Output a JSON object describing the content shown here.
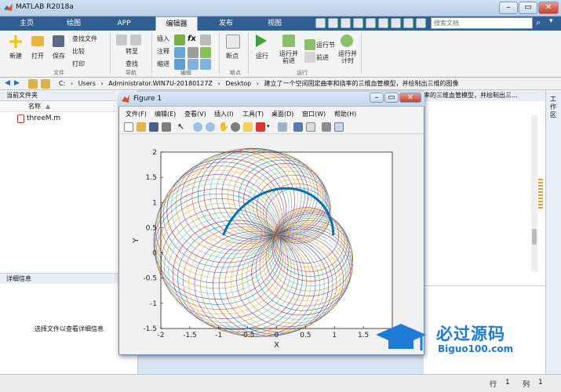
{
  "window": {
    "title": "MATLAB R2018a"
  },
  "tabs": [
    {
      "label": "主页"
    },
    {
      "label": "绘图"
    },
    {
      "label": "APP"
    },
    {
      "label": "编辑器"
    },
    {
      "label": "发布"
    },
    {
      "label": "视图"
    }
  ],
  "search": {
    "placeholder": "搜索文档"
  },
  "ribbon": {
    "file_group": "文件",
    "nav_group": "导航",
    "edit_group": "编辑",
    "breakpoint_group": "断点",
    "run_group": "运行",
    "new": "新建",
    "open": "打开",
    "save": "保存",
    "find_files": "查找文件",
    "compare": "比较",
    "print": "打印",
    "goto": "转至",
    "find": "查找",
    "insert": "插入",
    "comment": "注释",
    "indent": "缩进",
    "fx": "fx",
    "breakpoints": "断点",
    "run": "运行",
    "run_advance": "运行并\n前进",
    "run_section": "运行节",
    "advance": "前进",
    "run_time": "运行并\n计时"
  },
  "address": {
    "drive": "C:",
    "parts": [
      "Users",
      "Administrator.WIN7U-20180127Z",
      "Desktop",
      "建立了一个空间固定曲率和挠率的三维血管模型，并绘制出三维的图像"
    ]
  },
  "current_folder": {
    "header": "当前文件夹",
    "name_col": "名称",
    "files": [
      "threeM.m"
    ]
  },
  "details": {
    "header": "详细信息",
    "text": "选择文件以查看详细信息"
  },
  "right_pane": {
    "header_text": "率的三维血管模型，并绘制出三..."
  },
  "workspace": {
    "label": "工作区"
  },
  "figure": {
    "title": "Figure 1",
    "menu": [
      "文件(F)",
      "编辑(E)",
      "查看(V)",
      "插入(I)",
      "工具(T)",
      "桌面(D)",
      "窗口(W)",
      "帮助(H)"
    ]
  },
  "chart_data": {
    "type": "line",
    "title": "",
    "xlabel": "X",
    "ylabel": "Y",
    "xlim": [
      -2,
      2
    ],
    "ylim": [
      -1.5,
      2
    ],
    "xticks": [
      "-2",
      "-1.5",
      "-1",
      "-0.5",
      "0",
      "0.5",
      "1",
      "1.5"
    ],
    "yticks": [
      "-1.5",
      "-1",
      "-0.5",
      "0",
      "0.5",
      "1",
      "1.5",
      "2"
    ],
    "grid": false,
    "description_series": "many colored circles of radius r tangent at origin, centers rotating along a circle; blue center curve",
    "circle_radius": 0.55,
    "num_circles": 60,
    "center_curve_radius": 0.98,
    "center_arc_deg": [
      200,
      360
    ],
    "series_colors": [
      "#0072bd",
      "#d95319",
      "#edb120",
      "#7e2f8e",
      "#77ac30",
      "#4dbeee",
      "#a2142f"
    ],
    "center_curve_color": "#0072bd"
  },
  "status": {
    "row_label": "行",
    "row_value": "1",
    "col_label": "列",
    "col_value": "1"
  },
  "watermark": {
    "cn": "必过源码",
    "en": "Biguo100.com"
  }
}
